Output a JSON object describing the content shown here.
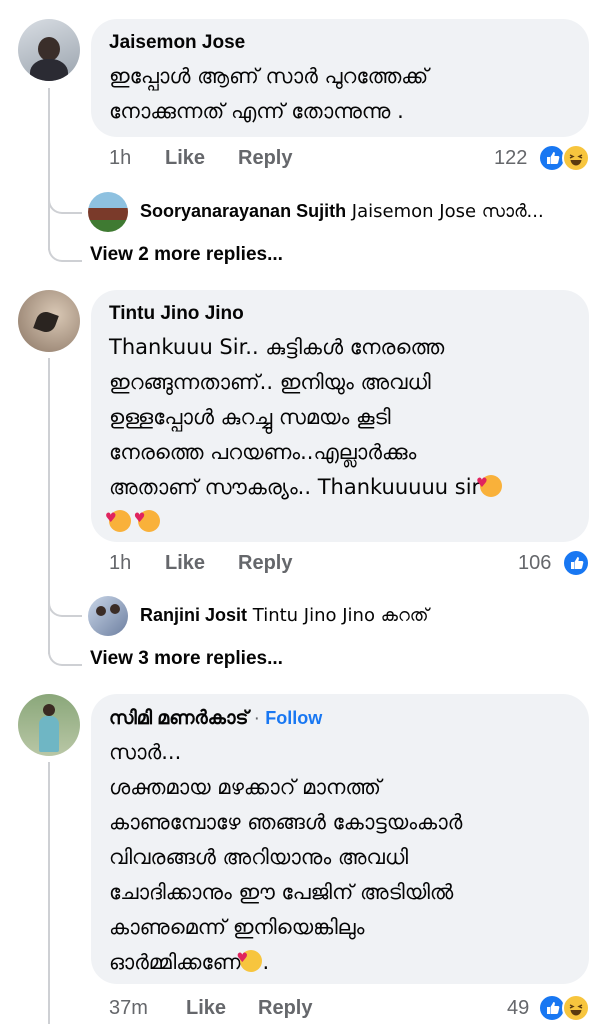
{
  "colors": {
    "bubble": "#f0f2f5",
    "meta": "#65676b",
    "link": "#1877f2",
    "line": "#ced0d4"
  },
  "comments": [
    {
      "author": "Jaisemon Jose",
      "lines": [
        "ഇപ്പോൾ ആണ് സാർ പുറത്തേക്ക്",
        "നോക്കുന്നത് എന്ന് തോന്നുന്നു ."
      ],
      "time": "1h",
      "like": "Like",
      "reply": "Reply",
      "count": "122",
      "reactions": [
        "like-icon",
        "haha-icon"
      ],
      "sub_reply": {
        "author": "Sooryanarayanan Sujith",
        "text": "Jaisemon Jose സാർ..."
      },
      "view_more": "View 2 more replies..."
    },
    {
      "author": "Tintu Jino Jino",
      "lines": [
        "Thankuuu Sir.. കുട്ടികൾ നേരത്തെ",
        "ഇറങ്ങുന്നതാണ്.. ഇനിയും അവധി",
        "ഉള്ളപ്പോൾ കുറച്ചു സമയം കൂടി",
        "നേരത്തെ പറയണം..എല്ലാർക്കും",
        "അതാണ് സൗകര്യം.. Thankuuuuu sir"
      ],
      "time": "1h",
      "like": "Like",
      "reply": "Reply",
      "count": "106",
      "reactions": [
        "like-icon"
      ],
      "sub_reply": {
        "author": "Ranjini Josit",
        "text": "Tintu Jino Jino കറത്"
      },
      "view_more": "View 3 more replies..."
    },
    {
      "author": "സിമി മണർകാട്",
      "follow_sep": "·",
      "follow": "Follow",
      "lines": [
        "സാർ...",
        "ശക്തമായ മഴക്കാറ് മാനത്ത്",
        "കാണുമ്പോഴേ ഞങ്ങൾ കോട്ടയംകാർ",
        "വിവരങ്ങൾ അറിയാനും അവധി",
        "ചോദിക്കാനും ഈ പേജിന് അടിയിൽ",
        "കാണുമെന്ന് ഇനിയെങ്കിലും",
        "ഓർമ്മിക്കണേ"
      ],
      "last_suffix": ".",
      "time": "37m",
      "like": "Like",
      "reply": "Reply",
      "count": "49",
      "reactions": [
        "like-icon",
        "haha-icon"
      ]
    }
  ]
}
